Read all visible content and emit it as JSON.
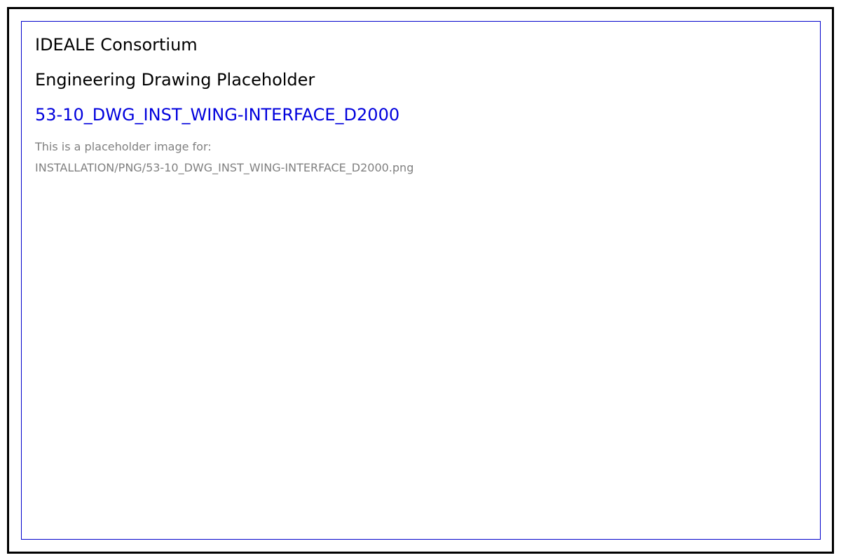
{
  "document": {
    "organization": "IDEALE Consortium",
    "heading": "Engineering Drawing Placeholder",
    "drawing_id": "53-10_DWG_INST_WING-INTERFACE_D2000",
    "note": "This is a placeholder image for:",
    "file_path": "INSTALLATION/PNG/53-10_DWG_INST_WING-INTERFACE_D2000.png"
  },
  "colors": {
    "outer_border": "#000000",
    "inner_border": "#0000cc",
    "drawing_id": "#0000dd",
    "note_text": "#808080"
  }
}
